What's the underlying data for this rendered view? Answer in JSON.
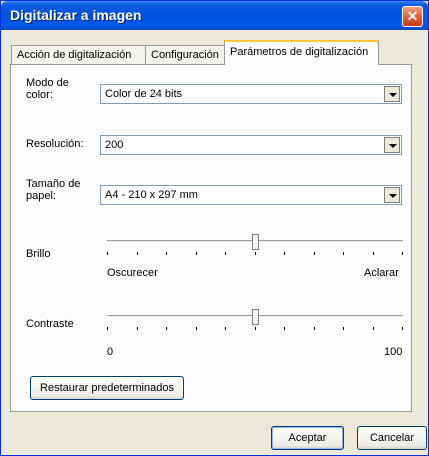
{
  "window": {
    "title": "Digitalizar a imagen"
  },
  "tabs": [
    {
      "label": "Acción de digitalización"
    },
    {
      "label": "Configuración"
    },
    {
      "label": "Parámetros de digitalización"
    }
  ],
  "color_mode": {
    "label": "Modo de\ncolor:",
    "value": "Color de 24 bits"
  },
  "resolution": {
    "label": "Resolución:",
    "value": "200"
  },
  "paper_size": {
    "label": "Tamaño de\npapel:",
    "value": "A4 - 210 x 297 mm"
  },
  "brightness": {
    "label": "Brillo",
    "min_label": "Oscurecer",
    "max_label": "Aclarar",
    "level": 0.5
  },
  "contrast": {
    "label": "Contraste",
    "min_label": "0",
    "max_label": "100",
    "level": 0.5
  },
  "restore_button": "Restaurar predeterminados",
  "ok_button": "Aceptar",
  "cancel_button": "Cancelar"
}
